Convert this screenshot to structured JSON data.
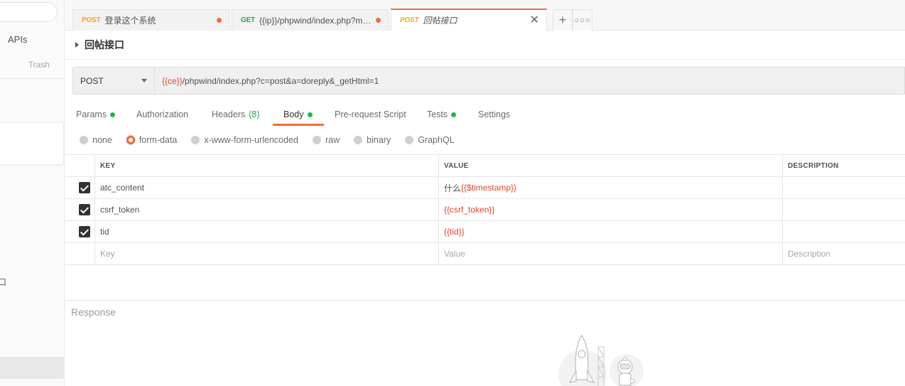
{
  "sidebar": {
    "apis_label": "APIs",
    "trash_label": "Trash",
    "fragment_text": "口"
  },
  "tabs": [
    {
      "method": "POST",
      "method_color": "#f5a623",
      "title": "登录这个系统",
      "unsaved": true,
      "active": false
    },
    {
      "method": "GET",
      "method_color": "#26a65b",
      "title": "{{ip}}/phpwind/index.php?m=u...",
      "unsaved": true,
      "active": false
    },
    {
      "method": "POST",
      "method_color": "#f5a623",
      "title": "回帖接口",
      "unsaved": false,
      "active": true
    }
  ],
  "tab_actions": {
    "add_icon": "plus-icon",
    "more_icon": "more-icon"
  },
  "request": {
    "name": "回帖接口",
    "method": "POST",
    "url_var": "{{ce}}",
    "url_rest": "/phpwind/index.php?c=post&a=doreply&_getHtml=1"
  },
  "subtabs": [
    {
      "label": "Params",
      "dot": true
    },
    {
      "label": "Authorization",
      "dot": false
    },
    {
      "label": "Headers",
      "count": "(8)",
      "dot": false
    },
    {
      "label": "Body",
      "dot": true,
      "active": true
    },
    {
      "label": "Pre-request Script",
      "dot": false
    },
    {
      "label": "Tests",
      "dot": true
    },
    {
      "label": "Settings",
      "dot": false
    }
  ],
  "body_types": [
    {
      "label": "none",
      "selected": false
    },
    {
      "label": "form-data",
      "selected": true
    },
    {
      "label": "x-www-form-urlencoded",
      "selected": false
    },
    {
      "label": "raw",
      "selected": false
    },
    {
      "label": "binary",
      "selected": false
    },
    {
      "label": "GraphQL",
      "selected": false
    }
  ],
  "table": {
    "headers": {
      "key": "KEY",
      "value": "VALUE",
      "description": "DESCRIPTION"
    },
    "rows": [
      {
        "checked": true,
        "key": "atc_content",
        "value_prefix": "什么",
        "value_var": "{{$timestamp}}"
      },
      {
        "checked": true,
        "key": "csrf_token",
        "value_prefix": "",
        "value_var": "{{csrf_token}}"
      },
      {
        "checked": true,
        "key": "tid",
        "value_prefix": "",
        "value_var": "{{tid}}"
      }
    ],
    "placeholders": {
      "key": "Key",
      "value": "Value",
      "description": "Description"
    }
  },
  "response": {
    "label": "Response"
  },
  "colors": {
    "accent": "#f26b3a",
    "variable": "#e0462c",
    "status_dot": "#26b34b"
  }
}
